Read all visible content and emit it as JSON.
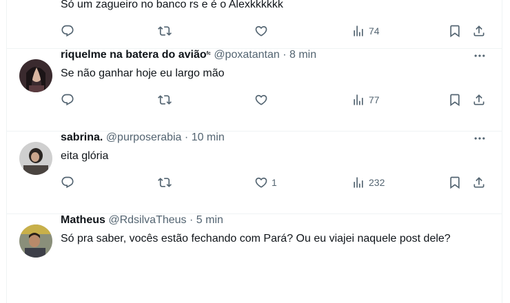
{
  "posts": [
    {
      "name": "",
      "badge": "",
      "handle": "",
      "time": "",
      "text": "Só um zagueiro no banco rs e é o Alexkkkkkk",
      "reply_count": "",
      "repost_count": "",
      "like_count": "",
      "view_count": "74"
    },
    {
      "name": "riquelme na batera do avião",
      "badge": "ᶠᶜ",
      "handle": "@poxatantan",
      "time": "8 min",
      "text": "Se não ganhar hoje eu largo mão",
      "reply_count": "",
      "repost_count": "",
      "like_count": "",
      "view_count": "77"
    },
    {
      "name": "sabrina.",
      "badge": "",
      "handle": "@purposerabia",
      "time": "10 min",
      "text": "eita glória",
      "reply_count": "",
      "repost_count": "",
      "like_count": "1",
      "view_count": "232"
    },
    {
      "name": "Matheus",
      "badge": "",
      "handle": "@RdsilvaTheus",
      "time": "5 min",
      "text": "Só pra saber, vocês estão fechando com Pará? Ou eu viajei naquele post dele?",
      "reply_count": "",
      "repost_count": "",
      "like_count": "",
      "view_count": ""
    }
  ],
  "separator": "·",
  "icons": {
    "reply": "reply-icon",
    "repost": "repost-icon",
    "like": "heart-icon",
    "views": "views-chart-icon",
    "bookmark": "bookmark-icon",
    "share": "share-icon",
    "more": "more-dots-icon"
  },
  "colors": {
    "text": "#0f1419",
    "secondary": "#536471",
    "border": "#eff3f4"
  }
}
